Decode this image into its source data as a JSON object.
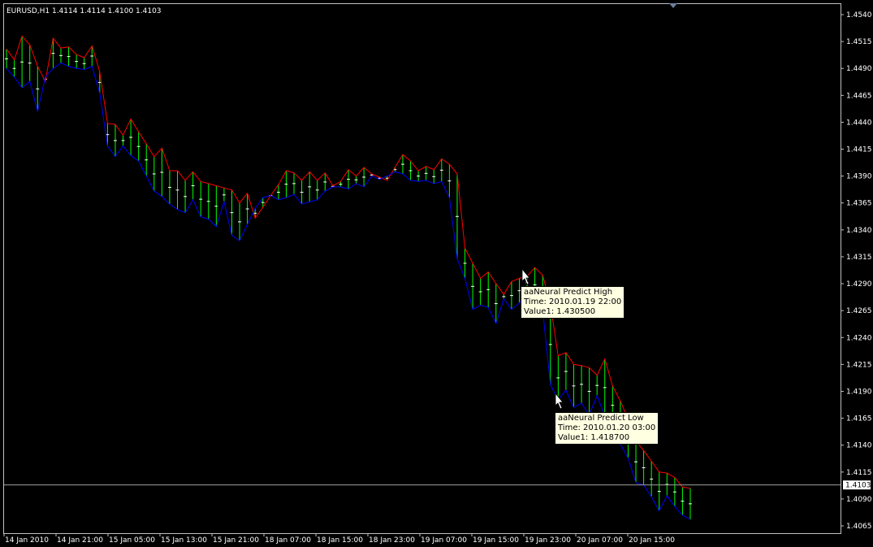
{
  "chart_data": {
    "type": "line",
    "symbol_header": "EURUSD,H1  1.4114 1.4114 1.4100 1.4103",
    "ylim": [
      1.4055,
      1.4555
    ],
    "y_ticks": [
      "1.4540",
      "1.4515",
      "1.4490",
      "1.4465",
      "1.4440",
      "1.4415",
      "1.4390",
      "1.4365",
      "1.4340",
      "1.4315",
      "1.4290",
      "1.4265",
      "1.4240",
      "1.4215",
      "1.4190",
      "1.4165",
      "1.4140",
      "1.4115",
      "1.4090",
      "1.4065"
    ],
    "x_ticks": [
      "14 Jan 2010",
      "14 Jan 21:00",
      "15 Jan 05:00",
      "15 Jan 13:00",
      "15 Jan 21:00",
      "18 Jan 07:00",
      "18 Jan 15:00",
      "18 Jan 23:00",
      "19 Jan 07:00",
      "19 Jan 15:00",
      "19 Jan 23:00",
      "20 Jan 07:00",
      "20 Jan 15:00"
    ],
    "current_price": "1.4103",
    "colors": {
      "high": "#ff0000",
      "low": "#0000ff",
      "bars": "#00ff00",
      "bar_ticks": "#ffffff",
      "axis": "#c0c0c0",
      "price_line": "#a0a0a0",
      "background": "#000000"
    },
    "series": [
      {
        "name": "aaNeural Predict High",
        "values": [
          1.4508,
          1.4498,
          1.452,
          1.4512,
          1.4492,
          1.4478,
          1.4518,
          1.4509,
          1.451,
          1.4503,
          1.45,
          1.4511,
          1.4487,
          1.4439,
          1.4438,
          1.4428,
          1.4443,
          1.4431,
          1.442,
          1.4408,
          1.4416,
          1.4395,
          1.4395,
          1.4386,
          1.4394,
          1.4385,
          1.4383,
          1.4381,
          1.4379,
          1.4377,
          1.4365,
          1.4374,
          1.4351,
          1.4361,
          1.4372,
          1.4382,
          1.4395,
          1.4393,
          1.4386,
          1.4394,
          1.4386,
          1.4393,
          1.4381,
          1.4385,
          1.4396,
          1.439,
          1.4398,
          1.4392,
          1.4389,
          1.4386,
          1.4398,
          1.441,
          1.4404,
          1.4395,
          1.4399,
          1.4396,
          1.4406,
          1.4401,
          1.4392,
          1.4323,
          1.4309,
          1.4295,
          1.4301,
          1.429,
          1.428,
          1.4292,
          1.4295,
          1.4297,
          1.4305,
          1.4298,
          1.4271,
          1.4223,
          1.4226,
          1.4215,
          1.4214,
          1.4212,
          1.4205,
          1.422,
          1.4195,
          1.4181,
          1.4164,
          1.4144,
          1.4135,
          1.4125,
          1.4115,
          1.4114,
          1.411,
          1.4101,
          1.41
        ]
      },
      {
        "name": "aaNeural Predict Low",
        "values": [
          1.449,
          1.4482,
          1.4472,
          1.4478,
          1.445,
          1.4482,
          1.449,
          1.4495,
          1.4492,
          1.449,
          1.4489,
          1.4492,
          1.4467,
          1.4418,
          1.4408,
          1.4418,
          1.4409,
          1.4404,
          1.439,
          1.4376,
          1.4371,
          1.4364,
          1.4359,
          1.4356,
          1.4368,
          1.4352,
          1.435,
          1.4343,
          1.4366,
          1.4335,
          1.433,
          1.4345,
          1.436,
          1.437,
          1.4372,
          1.4368,
          1.437,
          1.4373,
          1.4364,
          1.4366,
          1.4368,
          1.4376,
          1.438,
          1.438,
          1.4378,
          1.4383,
          1.438,
          1.439,
          1.4387,
          1.439,
          1.4394,
          1.4392,
          1.4386,
          1.4385,
          1.4386,
          1.4383,
          1.4385,
          1.437,
          1.4313,
          1.4295,
          1.4266,
          1.427,
          1.4268,
          1.4253,
          1.4276,
          1.4266,
          1.4272,
          1.4285,
          1.4273,
          1.4266,
          1.4196,
          1.4182,
          1.4191,
          1.4175,
          1.4179,
          1.4168,
          1.4186,
          1.4167,
          1.4159,
          1.4141,
          1.4128,
          1.4105,
          1.4103,
          1.4092,
          1.4079,
          1.4093,
          1.4083,
          1.4075,
          1.4071
        ]
      }
    ],
    "tooltips": [
      {
        "title": "aaNeural Predict High",
        "time": "Time: 2010.01.19 22:00",
        "value": "Value1: 1.430500"
      },
      {
        "title": "aaNeural Predict Low",
        "time": "Time: 2010.01.20 03:00",
        "value": "Value1: 1.418700"
      }
    ]
  }
}
